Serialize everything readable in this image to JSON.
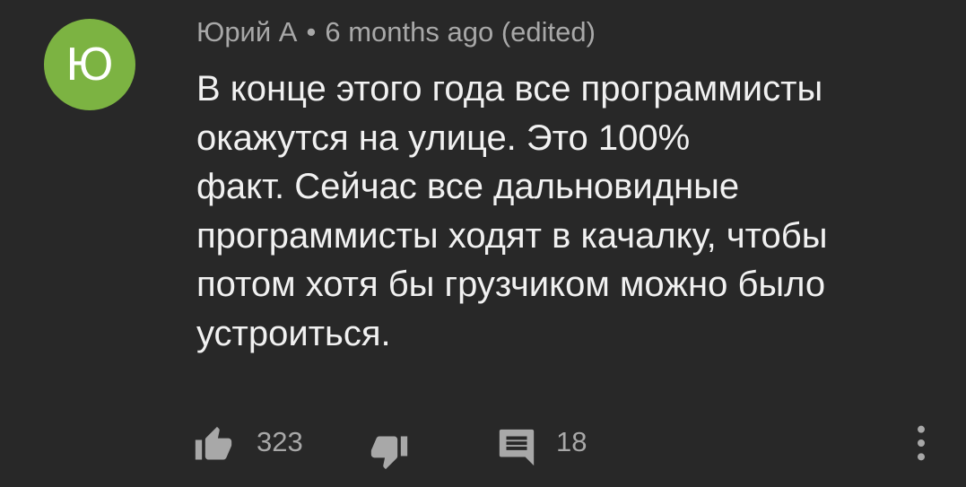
{
  "comment": {
    "avatar_letter": "Ю",
    "author": "Юрий А",
    "separator": "•",
    "time": "6 months ago",
    "edited": "(edited)",
    "text": "В конце этого года все программисты\nокажутся на улице. Это 100%\nфакт. Сейчас все дальновидные\nпрограммисты ходят в качалку, чтобы\nпотом хотя бы грузчиком можно было\nустроиться.",
    "likes": "323",
    "replies": "18"
  },
  "colors": {
    "background": "#282828",
    "avatar": "#7cb342",
    "text": "#f1f1f1",
    "secondary": "#a8a8a8"
  },
  "icons": [
    "thumb-up-icon",
    "thumb-down-icon",
    "comment-icon",
    "more-vert-icon"
  ]
}
